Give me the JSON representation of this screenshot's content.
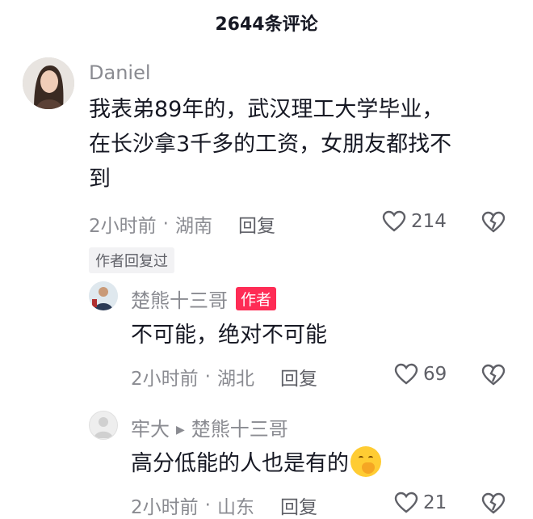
{
  "header": {
    "title": "2644条评论"
  },
  "comments": [
    {
      "username": "Daniel",
      "lines": [
        "我表弟89年的，武汉理工大学毕业，",
        "在长沙拿3千多的工资，女朋友都找不",
        "到"
      ],
      "time": "2小时前",
      "location": "湖南",
      "reply_label": "回复",
      "likes": "214",
      "author_replied_badge": "作者回复过"
    },
    {
      "username": "楚熊十三哥",
      "author_tag": "作者",
      "text": "不可能，绝对不可能",
      "time": "2小时前",
      "location": "湖北",
      "reply_label": "回复",
      "likes": "69"
    },
    {
      "username": "牢大",
      "reply_to": "楚熊十三哥",
      "text": "高分低能的人也是有的",
      "emoji": "grinning-face-hand-over-mouth",
      "time": "2小时前",
      "location": "山东",
      "reply_label": "回复",
      "likes": "21"
    }
  ]
}
